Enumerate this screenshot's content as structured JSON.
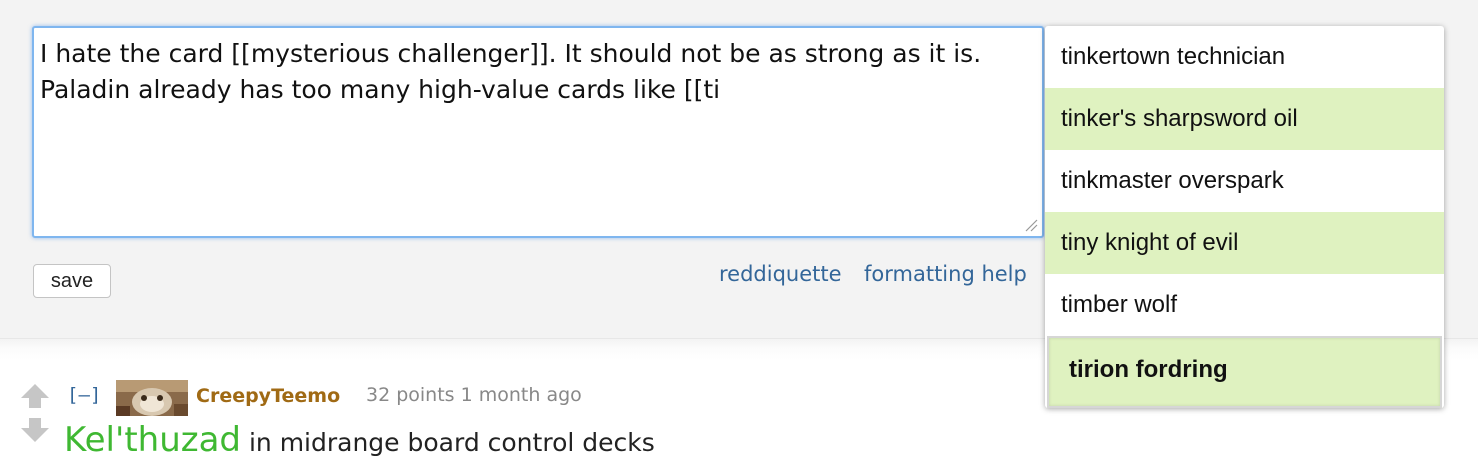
{
  "editor": {
    "text": "I hate the card [[mysterious challenger]]. It should not be as strong as it is. Paladin already has too many high-value cards like [[ti",
    "save_label": "save",
    "links": [
      "reddiquette",
      "formatting help"
    ]
  },
  "autocomplete": {
    "items": [
      {
        "label": "tinkertown technician",
        "highlighted": false
      },
      {
        "label": "tinker's sharpsword oil",
        "highlighted": true
      },
      {
        "label": "tinkmaster overspark",
        "highlighted": false
      },
      {
        "label": "tiny knight of evil",
        "highlighted": true
      },
      {
        "label": "timber wolf",
        "highlighted": false
      },
      {
        "label": "tirion fordring",
        "highlighted": true,
        "selected": true
      }
    ]
  },
  "comment": {
    "collapse_label": "[–]",
    "author": "CreepyTeemo",
    "score_text": "32 points 1 month ago",
    "body_link": "Kel'thuzad",
    "body_text": " in midrange board control decks",
    "icons": [
      "upvote-arrow-icon",
      "downvote-arrow-icon",
      "avatar"
    ]
  },
  "colors": {
    "link": "#336699",
    "highlight": "#dff2c0",
    "author": "#a06a14",
    "card_link": "#3fb832",
    "focus_border": "#7fb6ef"
  }
}
